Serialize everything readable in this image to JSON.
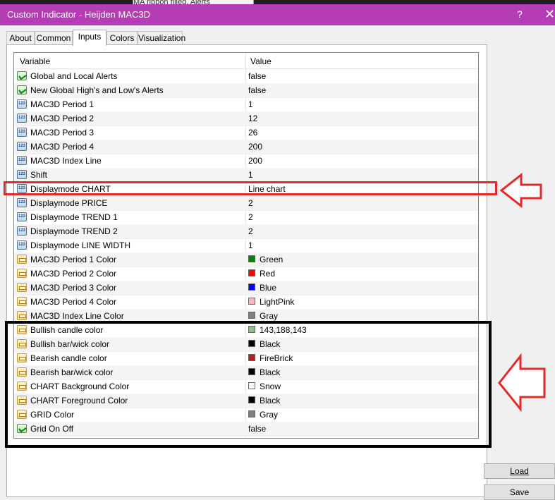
{
  "background_tab": "MA ribbon filled, Alerts",
  "window": {
    "title": "Custom Indicator - Heijden MAC3D",
    "help_label": "?",
    "close_label": "✕"
  },
  "tabs": [
    "About",
    "Common",
    "Inputs",
    "Colors",
    "Visualization"
  ],
  "active_tab": "Inputs",
  "grid": {
    "header_variable": "Variable",
    "header_value": "Value",
    "rows": [
      {
        "icon": "alert-icon",
        "variable": "Global and Local Alerts",
        "value": "false"
      },
      {
        "icon": "alert-icon",
        "variable": "New Global High's and Low's Alerts",
        "value": "false"
      },
      {
        "icon": "integer-icon",
        "variable": "MAC3D Period 1",
        "value": "1"
      },
      {
        "icon": "integer-icon",
        "variable": "MAC3D Period 2",
        "value": "12"
      },
      {
        "icon": "integer-icon",
        "variable": "MAC3D Period 3",
        "value": "26"
      },
      {
        "icon": "integer-icon",
        "variable": "MAC3D Period 4",
        "value": "200"
      },
      {
        "icon": "integer-icon",
        "variable": "MAC3D Index Line",
        "value": "200"
      },
      {
        "icon": "integer-icon",
        "variable": "Shift",
        "value": "1"
      },
      {
        "icon": "integer-icon",
        "variable": "Displaymode CHART",
        "value": "Line chart"
      },
      {
        "icon": "integer-icon",
        "variable": "Displaymode PRICE",
        "value": "2"
      },
      {
        "icon": "integer-icon",
        "variable": "Displaymode TREND 1",
        "value": "2"
      },
      {
        "icon": "integer-icon",
        "variable": "Displaymode TREND 2",
        "value": "2"
      },
      {
        "icon": "integer-icon",
        "variable": "Displaymode LINE WIDTH",
        "value": "1"
      },
      {
        "icon": "color-icon",
        "variable": "MAC3D Period 1 Color",
        "value": "Green",
        "swatch": "#008000"
      },
      {
        "icon": "color-icon",
        "variable": "MAC3D Period 2 Color",
        "value": "Red",
        "swatch": "#ff0000"
      },
      {
        "icon": "color-icon",
        "variable": "MAC3D Period 3 Color",
        "value": "Blue",
        "swatch": "#0000ff"
      },
      {
        "icon": "color-icon",
        "variable": "MAC3D Period 4 Color",
        "value": "LightPink",
        "swatch": "#ffb6c1"
      },
      {
        "icon": "color-icon",
        "variable": "MAC3D Index Line Color",
        "value": "Gray",
        "swatch": "#808080"
      },
      {
        "icon": "color-icon",
        "variable": "Bullish candle color",
        "value": "143,188,143",
        "swatch": "#8fbc8f"
      },
      {
        "icon": "color-icon",
        "variable": "Bullish bar/wick color",
        "value": "Black",
        "swatch": "#000000"
      },
      {
        "icon": "color-icon",
        "variable": "Bearish candle color",
        "value": "FireBrick",
        "swatch": "#b22222"
      },
      {
        "icon": "color-icon",
        "variable": "Bearish bar/wick color",
        "value": "Black",
        "swatch": "#000000"
      },
      {
        "icon": "color-icon",
        "variable": "CHART Background Color",
        "value": "Snow",
        "swatch": "#fffafa"
      },
      {
        "icon": "color-icon",
        "variable": "CHART Foreground Color",
        "value": "Black",
        "swatch": "#000000"
      },
      {
        "icon": "color-icon",
        "variable": "GRID Color",
        "value": "Gray",
        "swatch": "#808080"
      },
      {
        "icon": "alert-icon",
        "variable": "Grid On Off",
        "value": "false"
      }
    ]
  },
  "buttons": {
    "load": "Load",
    "save": "Save"
  },
  "annotation_colors": {
    "red_box": "#e22a2a",
    "black_box": "#000000"
  }
}
